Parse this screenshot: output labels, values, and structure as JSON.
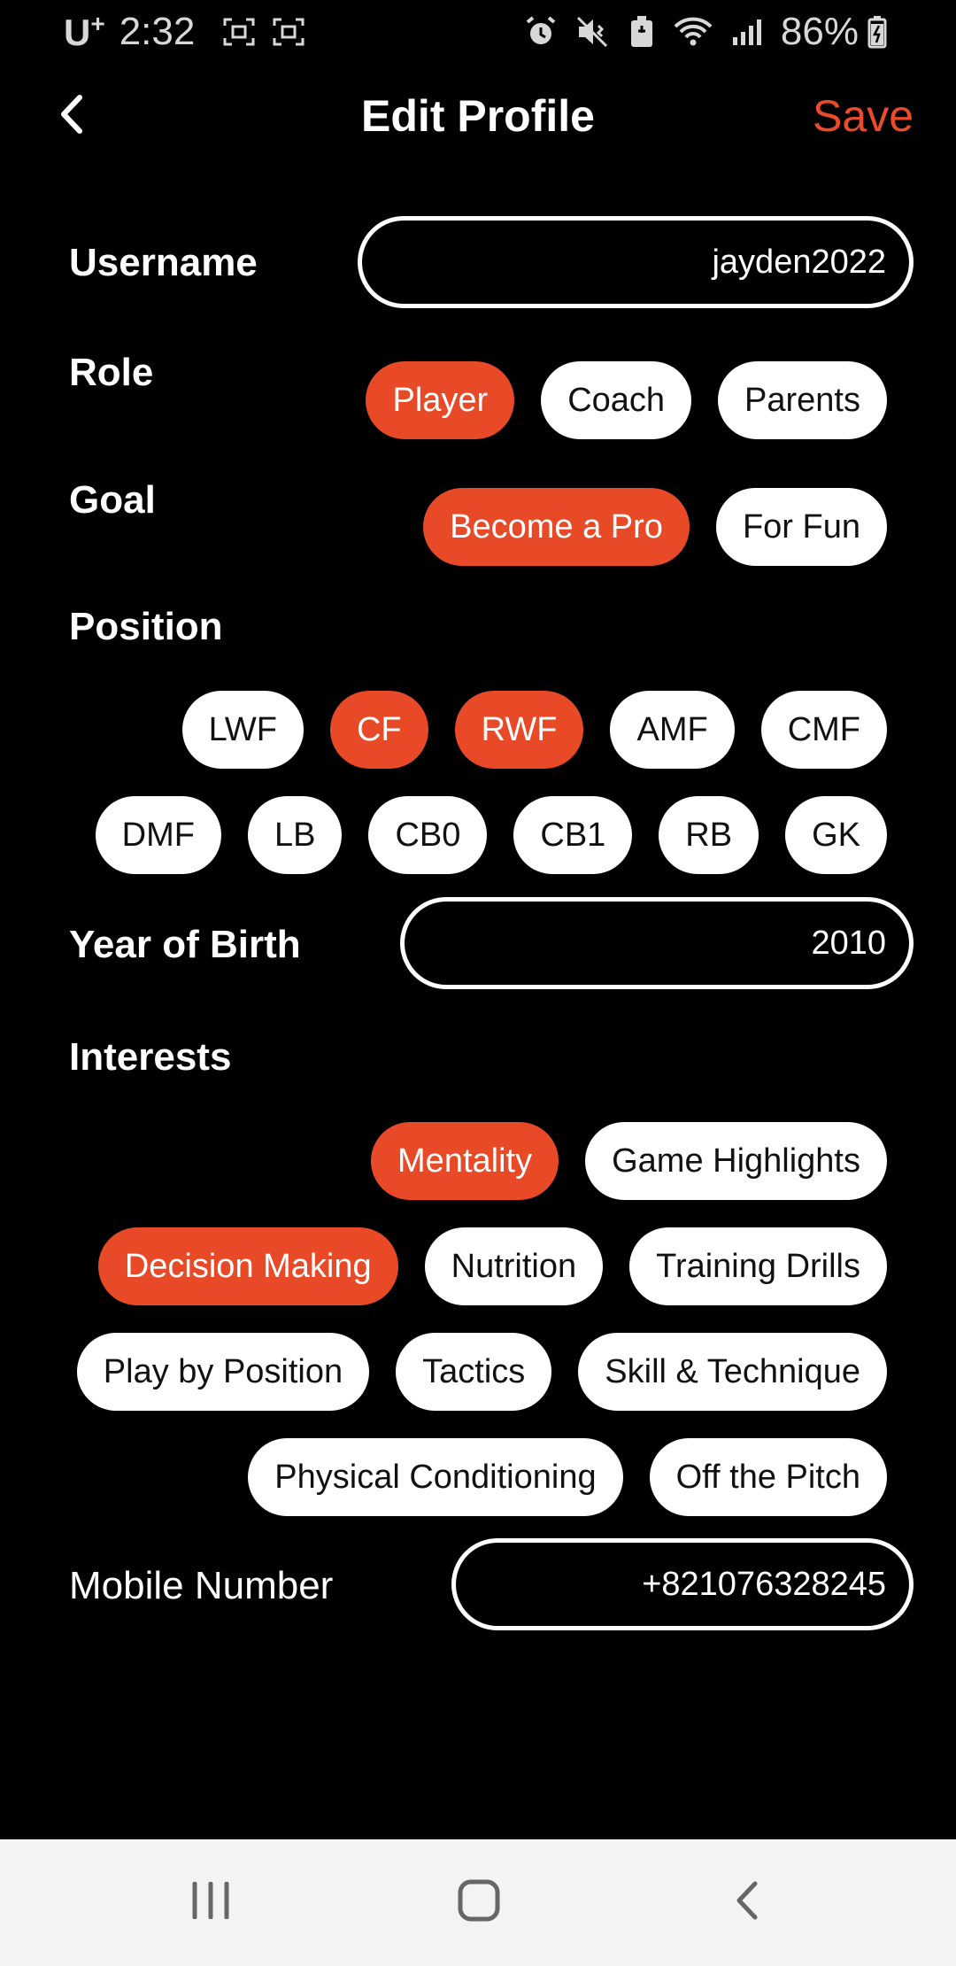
{
  "status_bar": {
    "carrier": "U",
    "carrier_sup": "+",
    "time": "2:32",
    "battery": "86%"
  },
  "header": {
    "title": "Edit Profile",
    "save_label": "Save"
  },
  "username": {
    "label": "Username",
    "value": "jayden2022"
  },
  "role": {
    "label": "Role",
    "options": [
      "Player",
      "Coach",
      "Parents"
    ],
    "selected": [
      "Player"
    ]
  },
  "goal": {
    "label": "Goal",
    "options": [
      "Become a Pro",
      "For Fun"
    ],
    "selected": [
      "Become a Pro"
    ]
  },
  "position": {
    "label": "Position",
    "row1": [
      "LWF",
      "CF",
      "RWF",
      "AMF",
      "CMF"
    ],
    "row2": [
      "DMF",
      "LB",
      "CB0",
      "CB1",
      "RB",
      "GK"
    ],
    "selected": [
      "CF",
      "RWF"
    ]
  },
  "year_of_birth": {
    "label": "Year of Birth",
    "value": "2010"
  },
  "interests": {
    "label": "Interests",
    "row1": [
      "Mentality",
      "Game Highlights"
    ],
    "row2": [
      "Decision Making",
      "Nutrition",
      "Training Drills"
    ],
    "row3": [
      "Play by Position",
      "Tactics",
      "Skill & Technique"
    ],
    "row4": [
      "Physical Conditioning",
      "Off the Pitch"
    ],
    "selected": [
      "Mentality",
      "Decision Making"
    ]
  },
  "mobile": {
    "label": "Mobile Number",
    "value": "+821076328245"
  },
  "colors": {
    "accent": "#e84a28",
    "background": "#000000",
    "chip": "#ffffff"
  },
  "icons": {
    "back": "chevron-left-icon",
    "nav_recents": "recents-icon",
    "nav_home": "home-icon",
    "nav_back": "nav-back-icon"
  }
}
